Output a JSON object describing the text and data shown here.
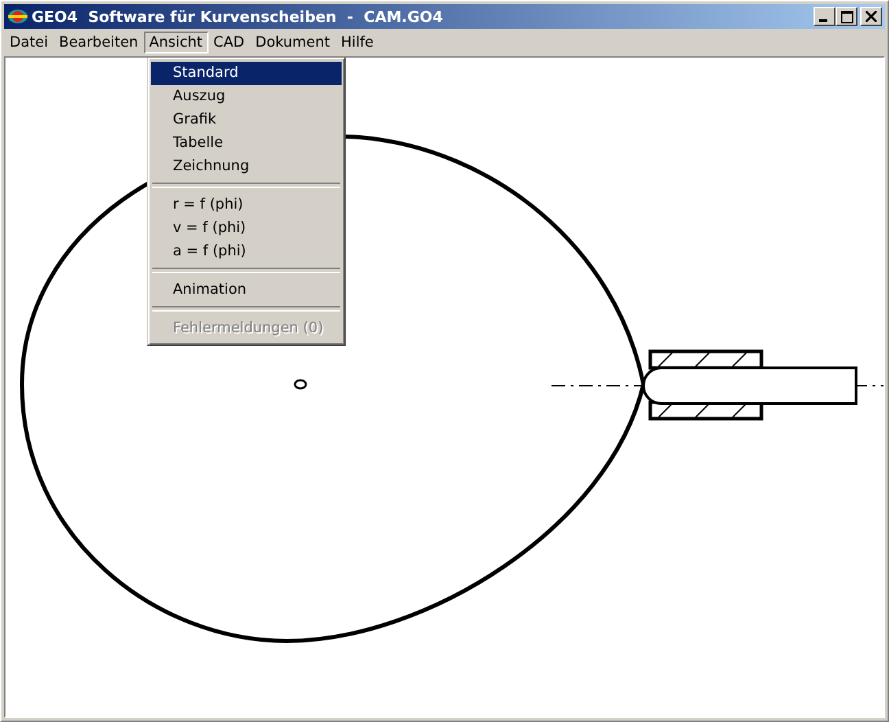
{
  "window": {
    "title": "GEO4  Software für Kurvenscheiben  -  CAM.GO4"
  },
  "menu_bar": [
    {
      "label": "Datei",
      "selected": false
    },
    {
      "label": "Bearbeiten",
      "selected": false
    },
    {
      "label": "Ansicht",
      "selected": true
    },
    {
      "label": "CAD",
      "selected": false
    },
    {
      "label": "Dokument",
      "selected": false
    },
    {
      "label": "Hilfe",
      "selected": false
    }
  ],
  "dropdown": [
    {
      "kind": "item",
      "label": "Standard",
      "selected": true,
      "disabled": false
    },
    {
      "kind": "item",
      "label": "Auszug",
      "selected": false,
      "disabled": false
    },
    {
      "kind": "item",
      "label": "Grafik",
      "selected": false,
      "disabled": false
    },
    {
      "kind": "item",
      "label": "Tabelle",
      "selected": false,
      "disabled": false
    },
    {
      "kind": "item",
      "label": "Zeichnung",
      "selected": false,
      "disabled": false
    },
    {
      "kind": "separator"
    },
    {
      "kind": "item",
      "label": "r = f (phi)",
      "selected": false,
      "disabled": false
    },
    {
      "kind": "item",
      "label": "v = f (phi)",
      "selected": false,
      "disabled": false
    },
    {
      "kind": "item",
      "label": "a = f (phi)",
      "selected": false,
      "disabled": false
    },
    {
      "kind": "separator"
    },
    {
      "kind": "item",
      "label": "Animation",
      "selected": false,
      "disabled": false
    },
    {
      "kind": "separator"
    },
    {
      "kind": "item",
      "label": "Fehlermeldungen (0)",
      "selected": false,
      "disabled": true
    }
  ]
}
